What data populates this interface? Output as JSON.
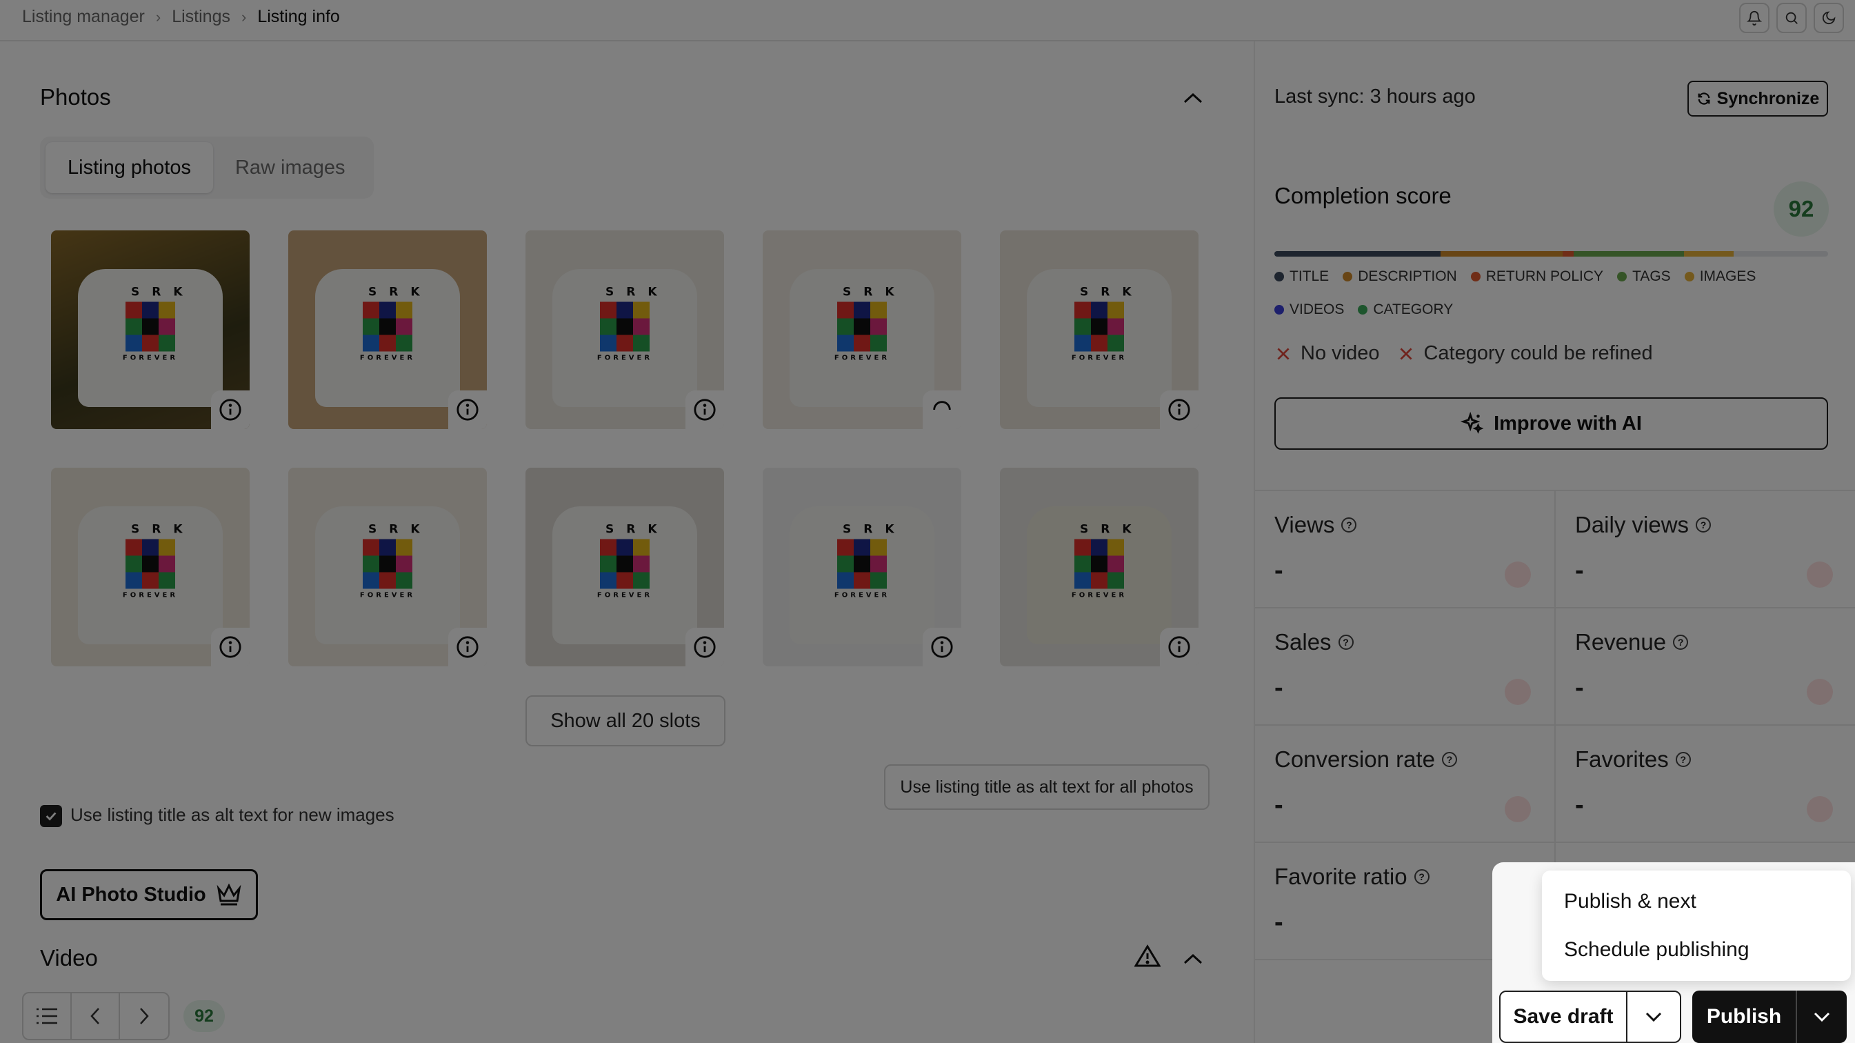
{
  "breadcrumb": [
    "Listing manager",
    "Listings",
    "Listing info"
  ],
  "photos_section": {
    "title": "Photos",
    "tabs": [
      "Listing photos",
      "Raw images"
    ],
    "show_all_label": "Show all 20 slots",
    "alt_checkbox_label": "Use listing title as alt text for new images",
    "alt_all_button": "Use listing title as alt text for all photos",
    "ai_studio_label": "AI Photo Studio"
  },
  "design": {
    "letters": "SRK",
    "footer": "FOREVER"
  },
  "video_section": {
    "title": "Video"
  },
  "bottom_nav": {
    "score": "92"
  },
  "sync": {
    "text": "Last sync: 3 hours ago",
    "button": "Synchronize"
  },
  "completion": {
    "title": "Completion score",
    "score": "92",
    "segments": [
      {
        "name": "TITLE",
        "color": "#3c4a5e",
        "weight": 0.3
      },
      {
        "name": "DESCRIPTION",
        "color": "#d08a2a",
        "weight": 0.22
      },
      {
        "name": "RETURN POLICY",
        "color": "#e05a2e",
        "weight": 0.02
      },
      {
        "name": "TAGS",
        "color": "#6aa84f",
        "weight": 0.2
      },
      {
        "name": "IMAGES",
        "color": "#e8b23a",
        "weight": 0.09
      },
      {
        "name": "VIDEOS",
        "color": "#3a3fd8",
        "weight": 0.0
      },
      {
        "name": "CATEGORY",
        "color": "#3bab5a",
        "weight": 0.0
      }
    ],
    "issues": [
      "No video",
      "Category could be refined"
    ],
    "improve_label": "Improve with AI"
  },
  "stats": [
    {
      "label": "Views",
      "value": "-"
    },
    {
      "label": "Daily views",
      "value": "-"
    },
    {
      "label": "Sales",
      "value": "-"
    },
    {
      "label": "Revenue",
      "value": "-"
    },
    {
      "label": "Conversion rate",
      "value": "-"
    },
    {
      "label": "Favorites",
      "value": "-"
    },
    {
      "label": "Favorite ratio",
      "value": "-"
    }
  ],
  "publish_menu": {
    "items": [
      "Publish & next",
      "Schedule publishing"
    ],
    "save_draft": "Save draft",
    "publish": "Publish"
  },
  "colors": {
    "overlay": "rgba(0,0,0,0.5)",
    "score_green_bg": "#e7f5ea",
    "score_green_text": "#2b7a3d",
    "issue_red": "#e0463a"
  },
  "icons": {
    "notification": "bell-icon",
    "search": "search-icon",
    "theme": "moon-icon",
    "collapse": "chevron-up-icon",
    "sync": "refresh-icon",
    "ai": "sparkles-icon",
    "crown": "crown-icon",
    "info": "info-icon",
    "warning": "warning-icon"
  }
}
